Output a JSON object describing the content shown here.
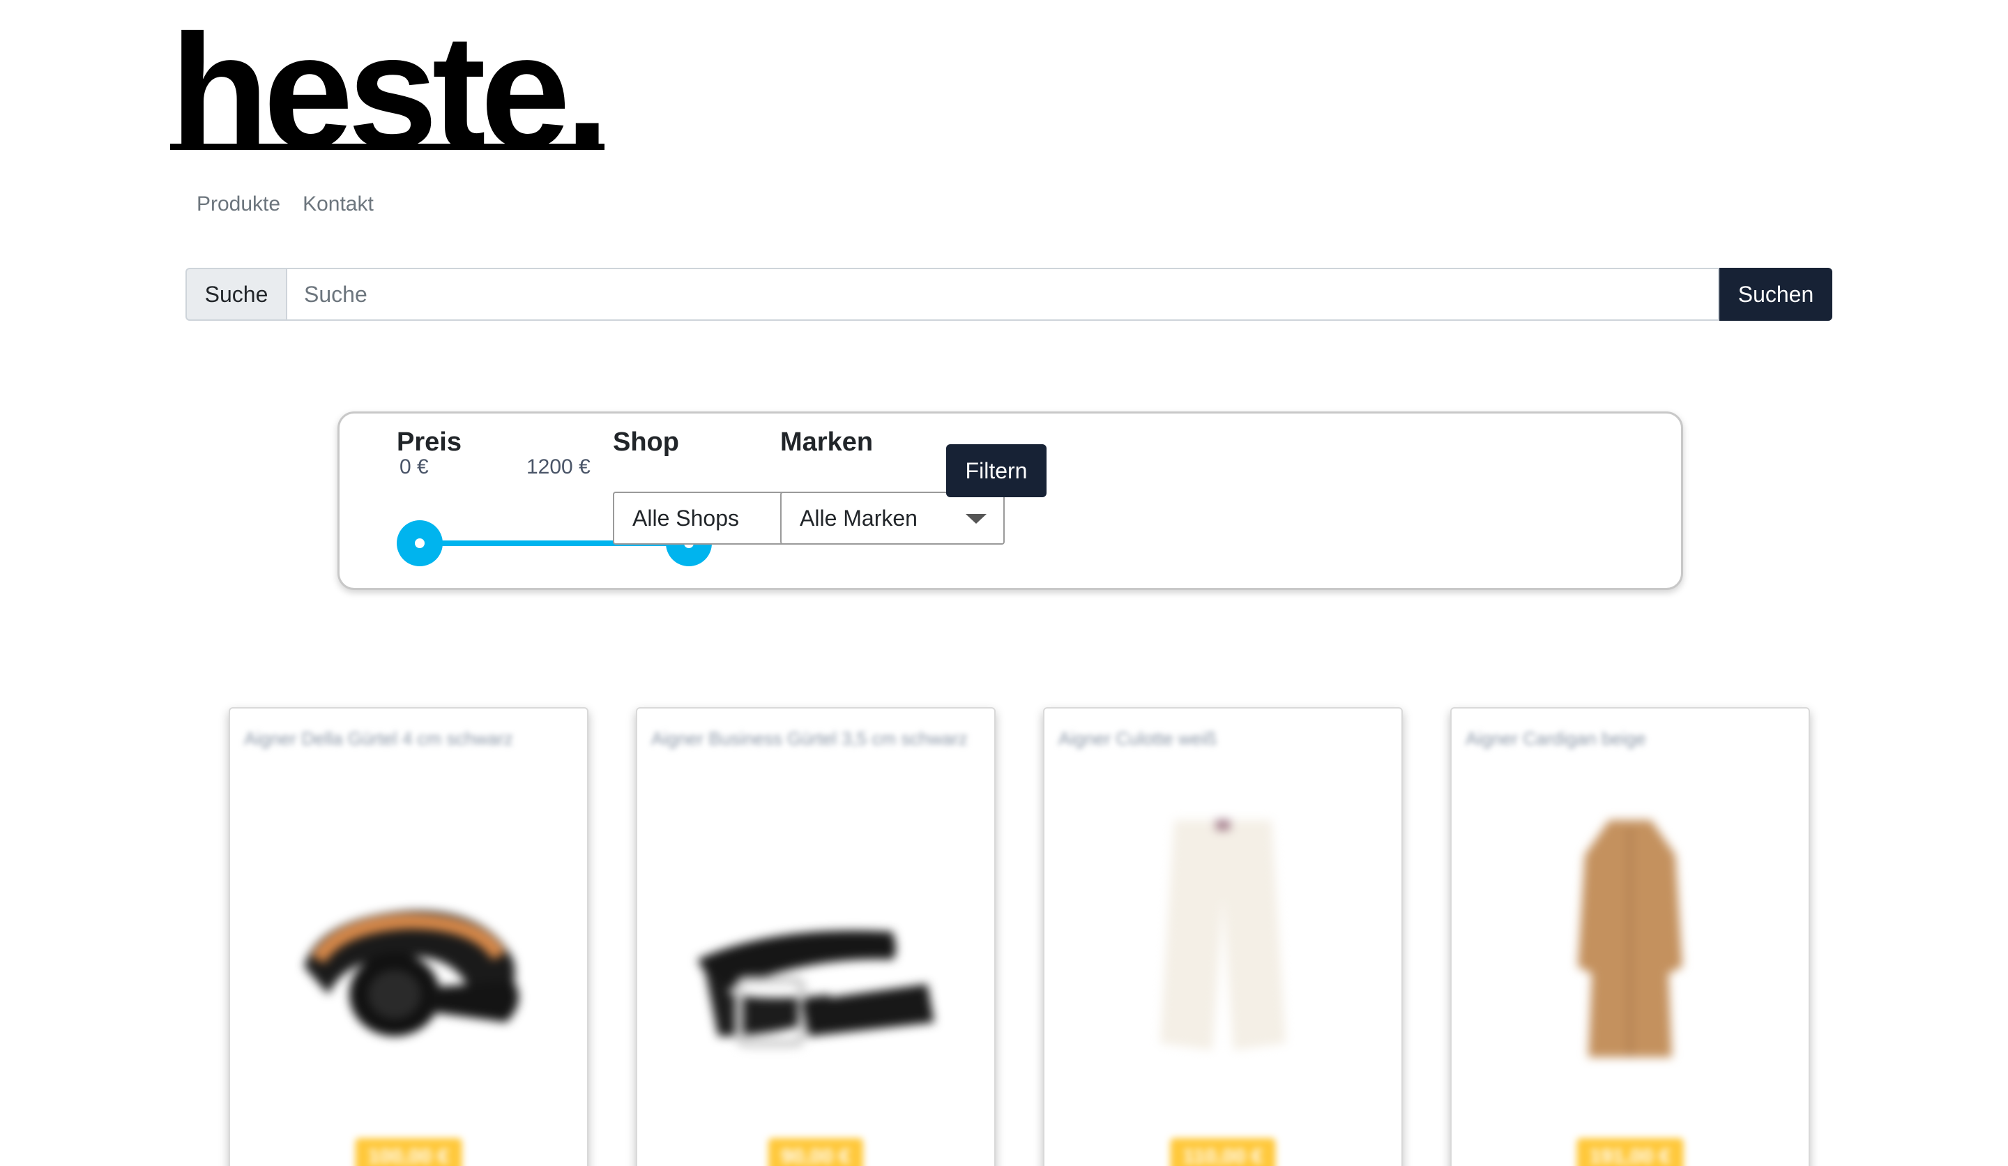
{
  "brand": {
    "logo": "heste."
  },
  "nav": {
    "items": [
      "Produkte",
      "Kontakt"
    ]
  },
  "search": {
    "prefix": "Suche",
    "placeholder": "Suche",
    "button": "Suchen"
  },
  "filters": {
    "price": {
      "title": "Preis",
      "min_label": "0 €",
      "max_label": "1200 €",
      "range": [
        0,
        1200
      ]
    },
    "shop": {
      "title": "Shop",
      "selected": "Alle Shops"
    },
    "brands": {
      "title": "Marken",
      "selected": "Alle Marken"
    },
    "submit": "Filtern"
  },
  "products": [
    {
      "title": "Aigner Della Gürtel 4 cm schwarz",
      "price": "100,00 €",
      "icon": "belt-wide-icon"
    },
    {
      "title": "Aigner Business Gürtel 3,5 cm schwarz",
      "price": "90,00 €",
      "icon": "belt-icon"
    },
    {
      "title": "Aigner Culotte weiß",
      "price": "110,00 €",
      "icon": "culotte-icon"
    },
    {
      "title": "Aigner Cardigan beige",
      "price": "191,00 €",
      "icon": "cardigan-icon"
    }
  ],
  "colors": {
    "accent": "#00b4ee",
    "dark_button": "#172235",
    "price_badge": "#ffc83a"
  }
}
